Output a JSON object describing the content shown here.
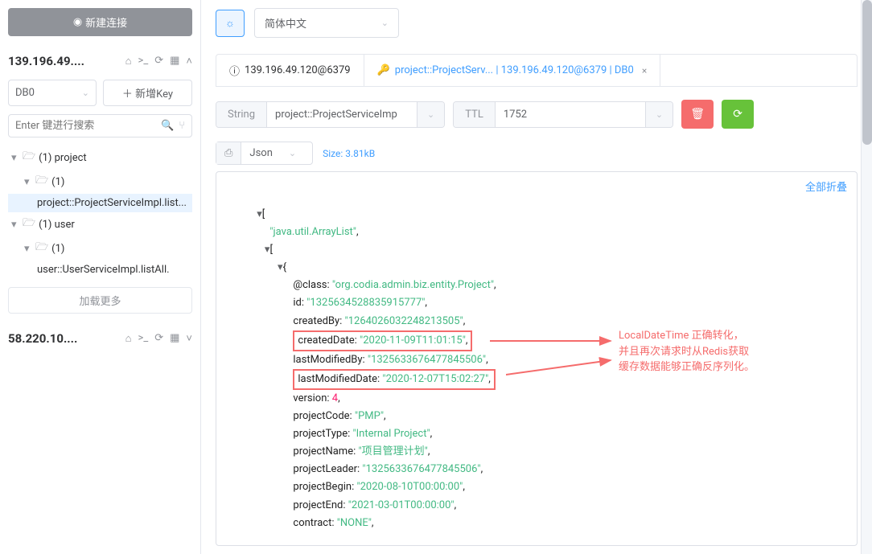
{
  "sidebar": {
    "new_conn_label": "新建连接",
    "servers": [
      {
        "title": "139.196.49....",
        "db_label": "DB0",
        "add_key_label": "＋ 新增Key",
        "search_placeholder": "Enter 键进行搜索",
        "tree": [
          {
            "type": "folder",
            "expanded": true,
            "label": "(1)  project",
            "indent": 0
          },
          {
            "type": "folder",
            "expanded": true,
            "label": "(1)",
            "indent": 1
          },
          {
            "type": "key",
            "label": "project::ProjectServiceImpl.list...",
            "indent": 2,
            "selected": true
          },
          {
            "type": "folder",
            "expanded": true,
            "label": "(1)  user",
            "indent": 0
          },
          {
            "type": "folder",
            "expanded": true,
            "label": "(1)",
            "indent": 1
          },
          {
            "type": "key",
            "label": "user::UserServiceImpl.listAll.",
            "indent": 2
          }
        ],
        "load_more": "加载更多"
      },
      {
        "title": "58.220.10....",
        "collapsed": true
      }
    ]
  },
  "top": {
    "lang_label": "简体中文"
  },
  "tabs": [
    {
      "label": "139.196.49.120@6379",
      "icon": "info",
      "active": false
    },
    {
      "label": "project::ProjectServ... | 139.196.49.120@6379 | DB0",
      "icon": "key",
      "active": true,
      "closable": true
    }
  ],
  "key_bar": {
    "type_label": "String",
    "key_value": "project::ProjectServiceImp",
    "ttl_label": "TTL",
    "ttl_value": "1752"
  },
  "format_bar": {
    "format_value": "Json",
    "size_label": "Size: 3.81kB"
  },
  "collapse_all_label": "全部折叠",
  "json": {
    "l0": "[",
    "l1_val": "\"java.util.ArrayList\"",
    "l2": "[",
    "l3": "{",
    "p_class_k": "@class: ",
    "p_class_v": "\"org.codia.admin.biz.entity.Project\"",
    "p_id_k": "id: ",
    "p_id_v": "\"1325634528835915777\"",
    "p_cb_k": "createdBy: ",
    "p_cb_v": "\"1264026032248213505\"",
    "p_cd_k": "createdDate: ",
    "p_cd_v": "\"2020-11-09T11:01:15\"",
    "p_lmb_k": "lastModifiedBy: ",
    "p_lmb_v": "\"1325633676477845506\"",
    "p_lmd_k": "lastModifiedDate: ",
    "p_lmd_v": "\"2020-12-07T15:02:27\"",
    "p_ver_k": "version: ",
    "p_ver_v": "4",
    "p_pc_k": "projectCode: ",
    "p_pc_v": "\"PMP\"",
    "p_pt_k": "projectType: ",
    "p_pt_v": "\"Internal Project\"",
    "p_pn_k": "projectName: ",
    "p_pn_v": "\"项目管理计划\"",
    "p_pl_k": "projectLeader: ",
    "p_pl_v": "\"1325633676477845506\"",
    "p_pb_k": "projectBegin: ",
    "p_pb_v": "\"2020-08-10T00:00:00\"",
    "p_pe_k": "projectEnd: ",
    "p_pe_v": "\"2021-03-01T00:00:00\"",
    "p_ct_k": "contract: ",
    "p_ct_v": "\"NONE\""
  },
  "annotation": {
    "line1": "LocalDateTime 正确转化，",
    "line2": "并且再次请求时从Redis获取",
    "line3": "缓存数据能够正确反序列化。"
  }
}
